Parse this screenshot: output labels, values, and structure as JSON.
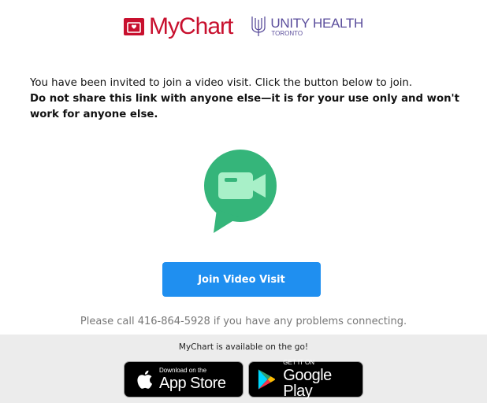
{
  "header": {
    "mychart_logo_text": "MyChart",
    "unity_logo_main": "UNITY HEALTH",
    "unity_logo_sub": "TORONTO"
  },
  "message": {
    "intro": "You have been invited to join a video visit. Click the button below to join.",
    "warning": "Do not share this link with anyone else—it is for your use only and won't work for anyone else."
  },
  "icon": {
    "name": "video-camera-chat-icon"
  },
  "join_button": {
    "label": "Join Video Visit"
  },
  "help": {
    "text": "Please call 416-864-5928 if you have any problems connecting."
  },
  "footer": {
    "label": "MyChart is available on the go!",
    "app_store": {
      "small": "Download on the",
      "big": "App Store"
    },
    "google_play": {
      "small": "GET IT ON",
      "big": "Google Play"
    }
  },
  "colors": {
    "mychart_red": "#c8102e",
    "unity_purple": "#5b4e9c",
    "icon_green": "#35b57a",
    "icon_light_green": "#a8f0c8",
    "button_blue": "#1f8ff0",
    "footer_gray": "#ececec"
  }
}
